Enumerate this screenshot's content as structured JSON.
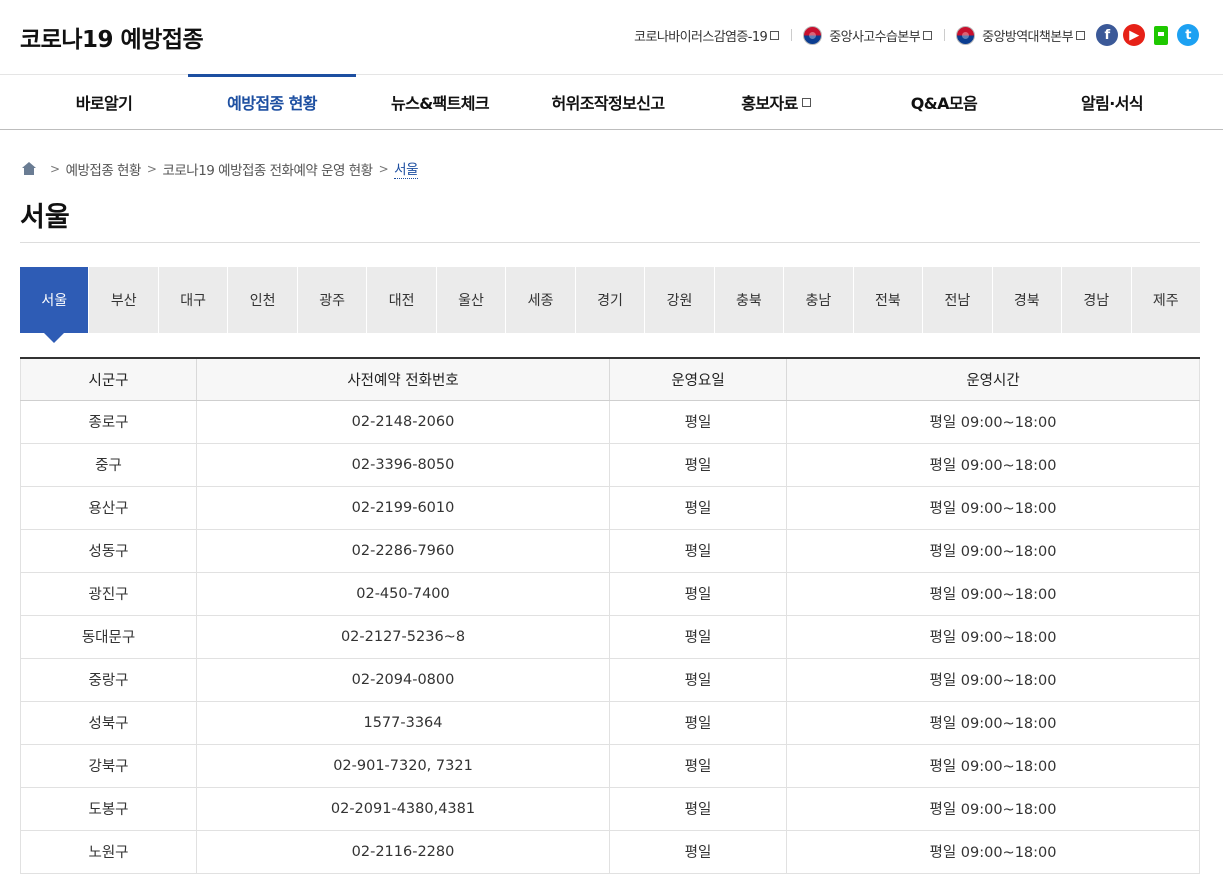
{
  "header": {
    "site_title": "코로나19 예방접종",
    "util_links": [
      {
        "label": "코로나바이러스감염증-19"
      },
      {
        "label": "중앙사고수습본부"
      },
      {
        "label": "중앙방역대책본부"
      }
    ],
    "social": [
      {
        "name": "facebook-icon",
        "glyph": "f",
        "color": "#3b5998"
      },
      {
        "name": "youtube-icon",
        "glyph": "▶",
        "color": "#e62117"
      },
      {
        "name": "blog-icon",
        "glyph": "",
        "color": "#1ec800"
      },
      {
        "name": "twitter-icon",
        "glyph": "t",
        "color": "#1da1f2"
      }
    ]
  },
  "gnb": [
    {
      "label": "바로알기"
    },
    {
      "label": "예방접종 현황",
      "active": true
    },
    {
      "label": "뉴스&팩트체크"
    },
    {
      "label": "허위조작정보신고"
    },
    {
      "label": "홍보자료",
      "external": true
    },
    {
      "label": "Q&A모음"
    },
    {
      "label": "알림·서식"
    }
  ],
  "breadcrumb": [
    "예방접종 현황",
    "코로나19 예방접종 전화예약 운영 현황",
    "서울"
  ],
  "page_title": "서울",
  "tabs": [
    "서울",
    "부산",
    "대구",
    "인천",
    "광주",
    "대전",
    "울산",
    "세종",
    "경기",
    "강원",
    "충북",
    "충남",
    "전북",
    "전남",
    "경북",
    "경남",
    "제주"
  ],
  "active_tab": "서울",
  "table": {
    "headers": [
      "시군구",
      "사전예약 전화번호",
      "운영요일",
      "운영시간"
    ],
    "rows": [
      [
        "종로구",
        "02-2148-2060",
        "평일",
        "평일 09:00~18:00"
      ],
      [
        "중구",
        "02-3396-8050",
        "평일",
        "평일 09:00~18:00"
      ],
      [
        "용산구",
        "02-2199-6010",
        "평일",
        "평일 09:00~18:00"
      ],
      [
        "성동구",
        "02-2286-7960",
        "평일",
        "평일 09:00~18:00"
      ],
      [
        "광진구",
        "02-450-7400",
        "평일",
        "평일 09:00~18:00"
      ],
      [
        "동대문구",
        "02-2127-5236~8",
        "평일",
        "평일 09:00~18:00"
      ],
      [
        "중랑구",
        "02-2094-0800",
        "평일",
        "평일 09:00~18:00"
      ],
      [
        "성북구",
        "1577-3364",
        "평일",
        "평일 09:00~18:00"
      ],
      [
        "강북구",
        "02-901-7320, 7321",
        "평일",
        "평일 09:00~18:00"
      ],
      [
        "도봉구",
        "02-2091-4380,4381",
        "평일",
        "평일 09:00~18:00"
      ],
      [
        "노원구",
        "02-2116-2280",
        "평일",
        "평일 09:00~18:00"
      ]
    ]
  },
  "colors": {
    "accent": "#1d4fa1",
    "tab_active": "#2e5cb5"
  }
}
